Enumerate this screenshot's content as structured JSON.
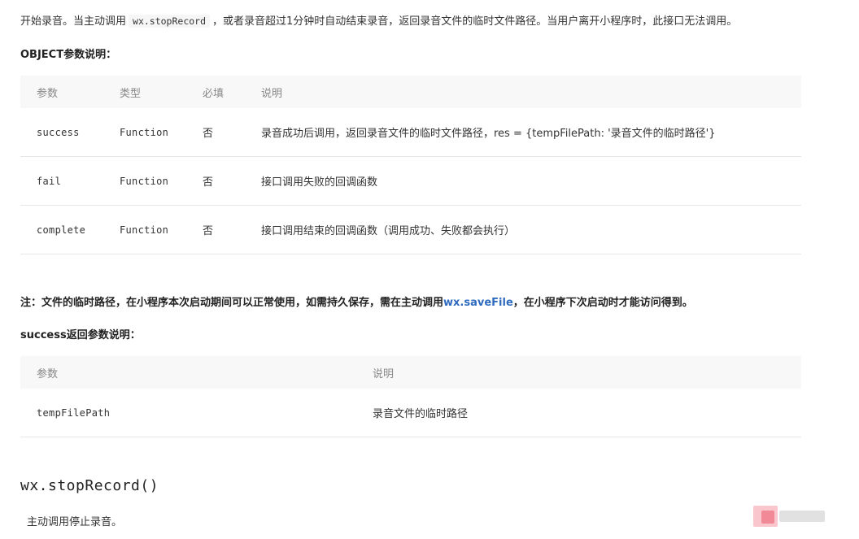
{
  "intro": {
    "before": "开始录音。当主动调用",
    "code": "wx.stopRecord",
    "after": "，或者录音超过1分钟时自动结束录音，返回录音文件的临时文件路径。当用户离开小程序时，此接口无法调用。"
  },
  "object_heading": "OBJECT参数说明：",
  "object_table": {
    "headers": [
      "参数",
      "类型",
      "必填",
      "说明"
    ],
    "rows": [
      {
        "name": "success",
        "type": "Function",
        "required": "否",
        "desc": "录音成功后调用，返回录音文件的临时文件路径，res = {tempFilePath: '录音文件的临时路径'}"
      },
      {
        "name": "fail",
        "type": "Function",
        "required": "否",
        "desc": "接口调用失败的回调函数"
      },
      {
        "name": "complete",
        "type": "Function",
        "required": "否",
        "desc": "接口调用结束的回调函数（调用成功、失败都会执行）"
      }
    ]
  },
  "note": {
    "before": "注：文件的临时路径，在小程序本次启动期间可以正常使用，如需持久保存，需在主动调用",
    "link": "wx.saveFile",
    "after": "，在小程序下次启动时才能访问得到。"
  },
  "success_heading": "success返回参数说明：",
  "success_table": {
    "headers": [
      "参数",
      "说明"
    ],
    "rows": [
      {
        "name": "tempFilePath",
        "desc": "录音文件的临时路径"
      }
    ]
  },
  "api_title": "wx.stopRecord()",
  "api_desc": "主动调用停止录音。",
  "colors": {
    "link": "#2f6bbf",
    "header_bg": "#f8f8f8",
    "row_border": "#e7e7e7"
  }
}
